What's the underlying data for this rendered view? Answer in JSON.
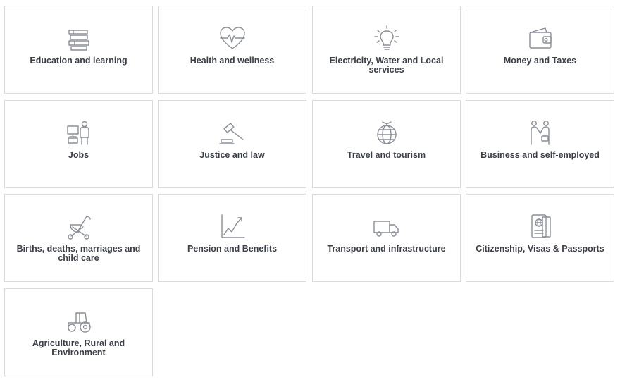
{
  "services": {
    "items": [
      {
        "label": "Education and learning",
        "icon": "books-icon"
      },
      {
        "label": "Health and wellness",
        "icon": "heart-pulse-icon"
      },
      {
        "label": "Electricity, Water and Local services",
        "icon": "lightbulb-icon"
      },
      {
        "label": "Money and Taxes",
        "icon": "wallet-icon"
      },
      {
        "label": "Jobs",
        "icon": "worker-computer-icon"
      },
      {
        "label": "Justice and law",
        "icon": "gavel-icon"
      },
      {
        "label": "Travel and tourism",
        "icon": "globe-plane-icon"
      },
      {
        "label": "Business and self-employed",
        "icon": "handshake-icon"
      },
      {
        "label": "Births, deaths, marriages and child care",
        "icon": "stroller-icon"
      },
      {
        "label": "Pension and Benefits",
        "icon": "growth-chart-icon"
      },
      {
        "label": "Transport and infrastructure",
        "icon": "truck-icon"
      },
      {
        "label": "Citizenship, Visas & Passports",
        "icon": "passport-icon"
      },
      {
        "label": "Agriculture, Rural and Environment",
        "icon": "tractor-icon"
      }
    ]
  },
  "colors": {
    "border": "#d9dadd",
    "icon": "#8a8e96",
    "text": "#3b3f47"
  }
}
